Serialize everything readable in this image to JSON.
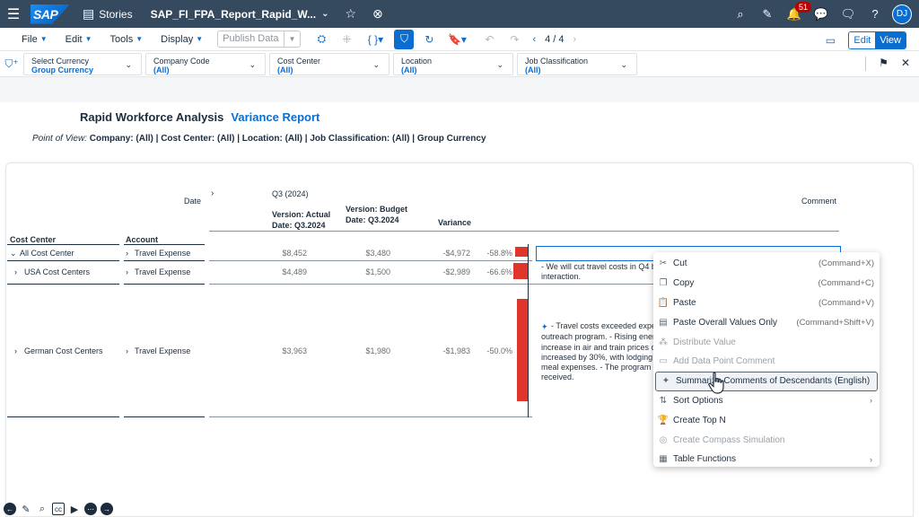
{
  "shell": {
    "logo": "SAP",
    "stories_label": "Stories",
    "doc_title": "SAP_FI_FPA_Report_Rapid_W...",
    "notification_count": "51",
    "avatar_initials": "DJ"
  },
  "toolbar": {
    "menus": [
      "File",
      "Edit",
      "Tools",
      "Display"
    ],
    "publish_label": "Publish Data",
    "page_indicator": "4 / 4",
    "edit_label": "Edit",
    "view_label": "View"
  },
  "filters": [
    {
      "label": "Select Currency",
      "value": "Group Currency"
    },
    {
      "label": "Company Code",
      "value": "(All)"
    },
    {
      "label": "Cost Center",
      "value": "(All)"
    },
    {
      "label": "Location",
      "value": "(All)"
    },
    {
      "label": "Job Classification",
      "value": "(All)"
    }
  ],
  "report": {
    "title": "Rapid Workforce Analysis",
    "subtitle": "Variance Report",
    "pov_label": "Point of View:",
    "pov_text": "Company: (All) | Cost Center: (All) | Location: (All) | Job Classification: (All) | Group Currency"
  },
  "table": {
    "header_date": "Date",
    "header_period": "Q3 (2024)",
    "col_actual": "Version: Actual",
    "col_actual_date": "Date: Q3.2024",
    "col_budget": "Version: Budget",
    "col_budget_date": "Date: Q3.2024",
    "col_variance": "Variance",
    "col_comment": "Comment",
    "col_cost_center": "Cost Center",
    "col_account": "Account",
    "rows": [
      {
        "cost_center": "All Cost Center",
        "account": "Travel Expense",
        "actual": "$8,452",
        "budget": "$3,480",
        "variance": "-$4,972",
        "pct": "-58.8%",
        "pct_value": -58.8,
        "comment": ""
      },
      {
        "cost_center": "USA Cost Centers",
        "account": "Travel Expense",
        "actual": "$4,489",
        "budget": "$1,500",
        "variance": "-$2,989",
        "pct": "-66.6%",
        "pct_value": -66.6,
        "comment": "- We will cut travel costs in Q4 by",
        "comment2": "interaction."
      },
      {
        "cost_center": "German Cost Centers",
        "account": "Travel Expense",
        "actual": "$3,963",
        "budget": "$1,980",
        "variance": "-$1,983",
        "pct": "-50.0%",
        "pct_value": -50.0,
        "comment_lines": [
          "- Travel costs exceeded exper",
          "outreach program. - Rising energ",
          "increase in air and train prices co",
          "increased by 30%, with lodging c",
          "meal expenses. - The program al",
          "received."
        ]
      }
    ]
  },
  "context_menu": [
    {
      "label": "Cut",
      "shortcut": "(Command+X)",
      "icon": "scissors-icon",
      "glyph": "✂",
      "disabled": false
    },
    {
      "label": "Copy",
      "shortcut": "(Command+C)",
      "icon": "copy-icon",
      "glyph": "❐",
      "disabled": false
    },
    {
      "label": "Paste",
      "shortcut": "(Command+V)",
      "icon": "paste-icon",
      "glyph": "📋",
      "disabled": false
    },
    {
      "label": "Paste Overall Values Only",
      "shortcut": "(Command+Shift+V)",
      "icon": "paste-values-icon",
      "glyph": "▤",
      "disabled": false
    },
    {
      "label": "Distribute Value",
      "shortcut": "",
      "icon": "distribute-icon",
      "glyph": "⁂",
      "disabled": true
    },
    {
      "label": "Add Data Point Comment",
      "shortcut": "",
      "icon": "comment-icon",
      "glyph": "▭",
      "disabled": true
    },
    {
      "label": "Summarize Comments of Descendants (English)",
      "shortcut": "",
      "icon": "sparkle-icon",
      "glyph": "✦",
      "disabled": false,
      "highlight": true
    },
    {
      "label": "Sort Options",
      "shortcut": "",
      "icon": "sort-icon",
      "glyph": "⇅",
      "disabled": false,
      "submenu": true
    },
    {
      "label": "Create Top N",
      "shortcut": "",
      "icon": "trophy-icon",
      "glyph": "🏆",
      "disabled": false
    },
    {
      "label": "Create Compass Simulation",
      "shortcut": "",
      "icon": "compass-icon",
      "glyph": "◎",
      "disabled": true
    },
    {
      "label": "Table Functions",
      "shortcut": "",
      "icon": "table-icon",
      "glyph": "▦",
      "disabled": false,
      "submenu": true
    }
  ]
}
